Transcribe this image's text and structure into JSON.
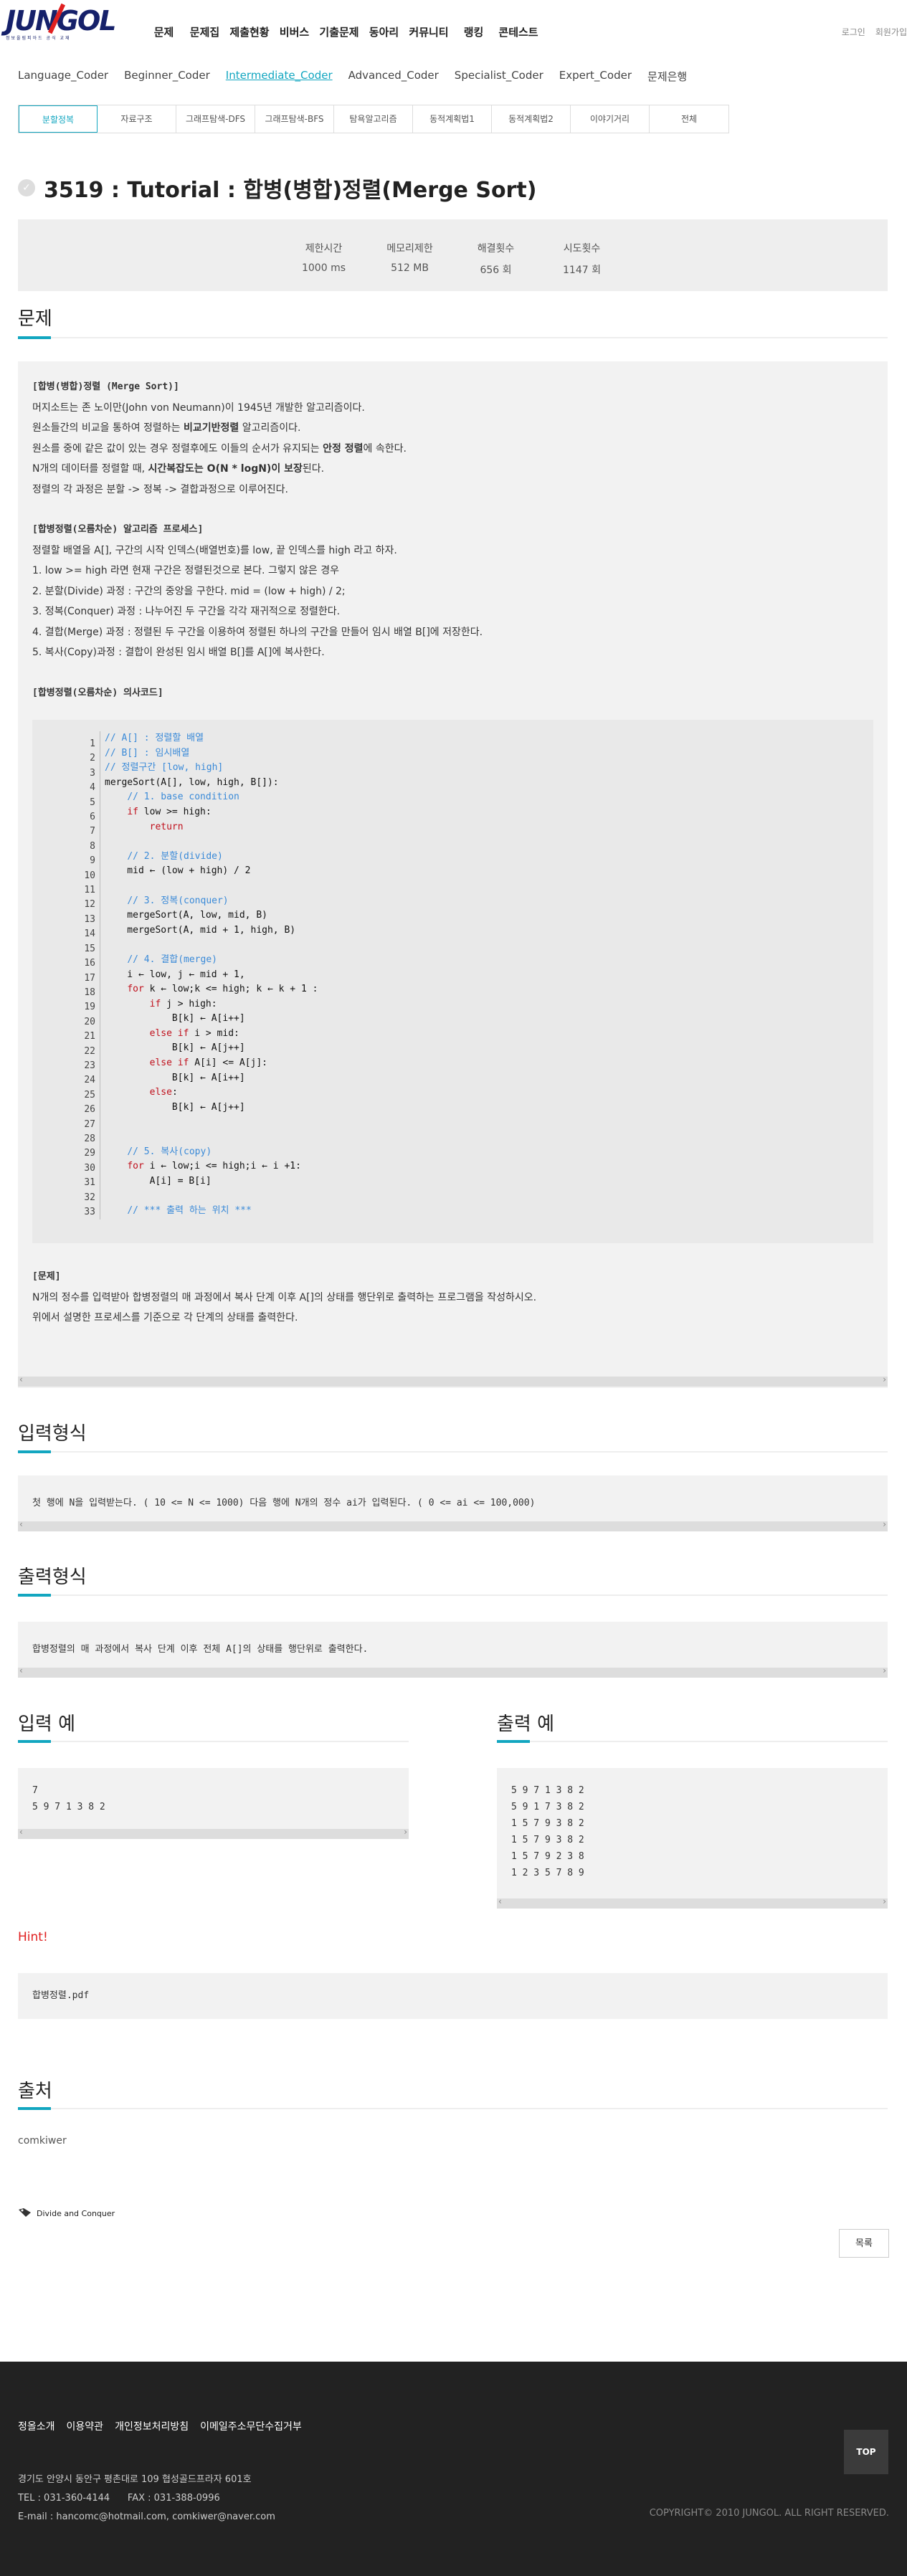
{
  "header": {
    "logo": "JUNGOL",
    "logo_sub": "정보올림피아드 공식 교재",
    "nav": [
      "문제",
      "문제집",
      "제출현황",
      "비버스",
      "기출문제",
      "동아리",
      "커뮤니티",
      "랭킹",
      "콘테스트"
    ],
    "util": [
      "로그인",
      "회원가입"
    ]
  },
  "levelnav": [
    "Language_Coder",
    "Beginner_Coder",
    "Intermediate_Coder",
    "Advanced_Coder",
    "Specialist_Coder",
    "Expert_Coder",
    "문제은행"
  ],
  "subtabs": [
    "분할정복",
    "자료구조",
    "그래프탐색-DFS",
    "그래프탐색-BFS",
    "탐욕알고리즘",
    "동적계획법1",
    "동적계획법2",
    "이야기거리",
    "전체"
  ],
  "problem": {
    "title": "3519 : Tutorial : 합병(병합)정렬(Merge Sort)",
    "info": [
      {
        "label": "제한시간",
        "value": "1000 ms"
      },
      {
        "label": "메모리제한",
        "value": "512 MB"
      },
      {
        "label": "해결횟수",
        "value": "656 회"
      },
      {
        "label": "시도횟수",
        "value": "1147 회"
      }
    ]
  },
  "sections": {
    "problem": "문제",
    "input": "입력형식",
    "output": "출력형식",
    "sample_input": "입력 예",
    "sample_output": "출력 예",
    "hint": "Hint!",
    "source": "출처"
  },
  "desc": {
    "h1": "[합병(병합)정렬 (Merge Sort)]",
    "l1": "머지소트는 존 노이만(John von Neumann)이 1945년 개발한 알고리즘이다.",
    "l2a": "원소들간의 비교을 통하여 정렬하는 ",
    "l2b": "비교기반정렬",
    "l2c": " 알고리즘이다.",
    "l3a": "원소를 중에 같은 값이 있는 경우 정렬후에도 이들의 순서가 유지되는 ",
    "l3b": "안정 정렬",
    "l3c": "에 속한다.",
    "l4a": "N개의 데이터를 정렬할 때, ",
    "l4b": "시간복잡도는 O(N * logN)이 보장",
    "l4c": "된다.",
    "l5": "정렬의 각 과정은 분할 -> 정복 -> 결합과정으로 이루어진다.",
    "h2": "[합병정렬(오름차순) 알고리즘 프로세스]",
    "p1": "정렬할 배열을 A[], 구간의 시작 인덱스(배열번호)를 low, 끝 인덱스를 high 라고 하자.",
    "p2": "1. low >= high 라면 현재 구간은 정렬된것으로 본다. 그렇지 않은 경우",
    "p3": "2. 분할(Divide) 과정 : 구간의 중앙을 구한다. mid = (low + high) / 2;",
    "p4": "3. 정복(Conquer) 과정 : 나누어진 두 구간을 각각 재귀적으로 정렬한다.",
    "p5": "4. 결합(Merge) 과정 : 정렬된 두 구간을 이용하여 정렬된 하나의 구간을 만들어 임시 배열 B[]에 저장한다.",
    "p6": "5. 복사(Copy)과정 : 결합이 완성된 임시 배열 B[]를 A[]에 복사한다.",
    "h3": "[합병정렬(오름차순) 의사코드]",
    "h4": "[문제]",
    "q1": "N개의 정수를 입력받아 합병정렬의 매 과정에서 복사 단계 이후 A[]의 상태를 행단위로 출력하는 프로그램을 작성하시오.",
    "q2": "위에서 설명한 프로세스를 기준으로 각 단계의 상태를 출력한다."
  },
  "code": {
    "line_numbers": "1\n2\n3\n4\n5\n6\n7\n8\n9\n10\n11\n12\n13\n14\n15\n16\n17\n18\n19\n20\n21\n22\n23\n24\n25\n26\n27\n28\n29\n30\n31\n32\n33",
    "lines": [
      "// A[] : 정렬할 배열",
      "// B[] : 임시배열",
      "// 정렬구간 [low, high]",
      "mergeSort(A[], low, high, B[]):",
      "    // 1. base condition",
      "    if low >= high:",
      "        return",
      "",
      "    // 2. 분할(divide)",
      "    mid ← (low + high) / 2",
      "",
      "    // 3. 정복(conquer)",
      "    mergeSort(A, low, mid, B)",
      "    mergeSort(A, mid + 1, high, B)",
      "",
      "    // 4. 결합(merge)",
      "    i ← low, j ← mid + 1,",
      "    for k ← low;k <= high; k ← k + 1 :",
      "        if j > high:",
      "            B[k] ← A[i++]",
      "        else if i > mid:",
      "            B[k] ← A[j++]",
      "        else if A[i] <= A[j]:",
      "            B[k] ← A[i++]",
      "        else:",
      "            B[k] ← A[j++]",
      "",
      "",
      "    // 5. 복사(copy)",
      "    for i ← low;i <= high;i ← i +1:",
      "        A[i] = B[i]",
      "",
      "    // *** 출력 하는 위치 ***"
    ]
  },
  "input_format": "첫 행에 N을 입력받는다. ( 10 <= N <= 1000) 다음 행에 N개의 정수 ai가 입력된다. ( 0 <= ai <= 100,000)",
  "output_format": "합병정렬의 매 과정에서 복사 단계 이후 전체 A[]의 상태를 행단위로 출력한다.",
  "sample_input": "7\n5 9 7 1 3 8 2",
  "sample_output": "5 9 7 1 3 8 2\n5 9 1 7 3 8 2\n1 5 7 9 3 8 2\n1 5 7 9 3 8 2\n1 5 7 9 2 3 8\n1 2 3 5 7 8 9",
  "hint_file": "합병정렬.pdf",
  "source_text": "comkiwer",
  "tag": "Divide and Conquer",
  "list_button": "목록",
  "footer": {
    "links": [
      "정올소개",
      "이용약관",
      "개인정보처리방침",
      "이메일주소무단수집거부"
    ],
    "address": "경기도 안양시 동안구 평촌대로 109 협성골드프라자 601호",
    "tel": "TEL : 031-360-4144      FAX : 031-388-0996",
    "email": "E-mail : hancomc@hotmail.com, comkiwer@naver.com",
    "copyright": "COPYRIGHT© 2010 JUNGOL. ALL RIGHT RESERVED.",
    "top": "TOP"
  },
  "colors": {
    "accent": "#12a6c0",
    "logo": "#16216a",
    "hint": "#e02020"
  }
}
